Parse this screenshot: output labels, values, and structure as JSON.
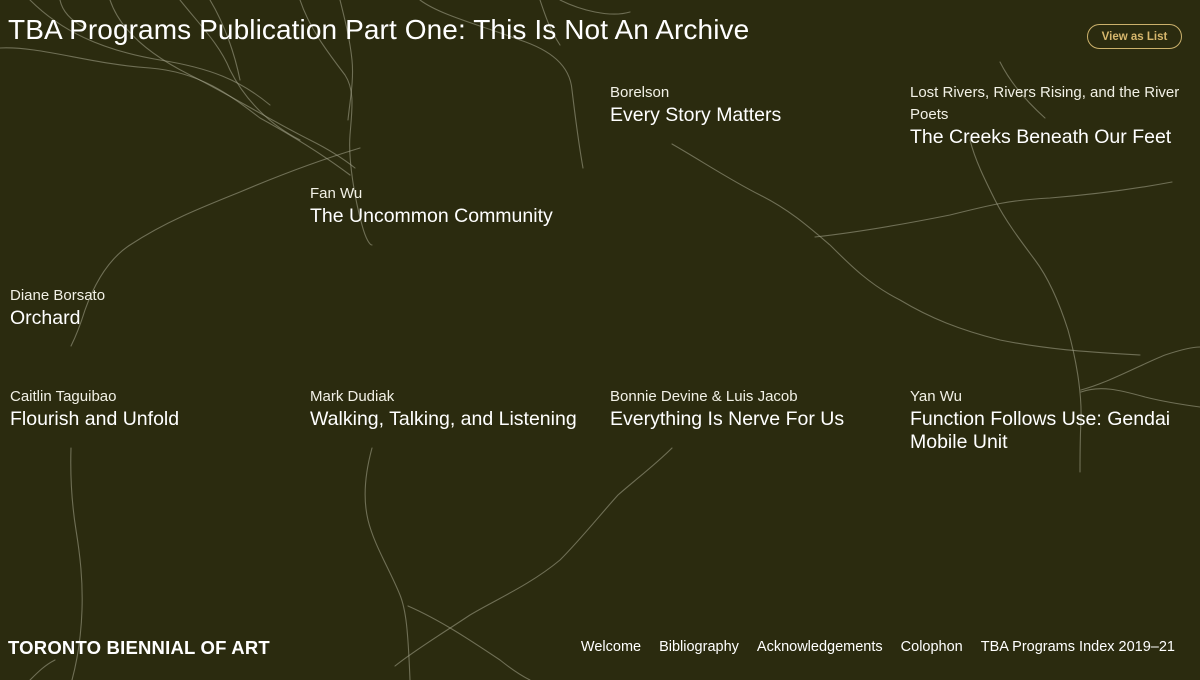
{
  "header": {
    "title": "TBA Programs Publication Part One: This Is Not An Archive",
    "view_button_label": "View as List"
  },
  "entries": [
    {
      "artist": "Borelson",
      "work": "Every Story Matters"
    },
    {
      "artist": "Lost Rivers, Rivers Rising, and the River Poets",
      "work": "The Creeks Beneath Our Feet"
    },
    {
      "artist": "Fan Wu",
      "work": "The Uncommon Community"
    },
    {
      "artist": "Diane Borsato",
      "work": "Orchard"
    },
    {
      "artist": "Caitlin Taguibao",
      "work": "Flourish and Unfold"
    },
    {
      "artist": "Mark Dudiak",
      "work": "Walking, Talking, and Listening"
    },
    {
      "artist": "Bonnie Devine & Luis Jacob",
      "work": "Everything Is Nerve For Us"
    },
    {
      "artist": "Yan Wu",
      "work": "Function Follows Use: Gendai Mobile Unit"
    }
  ],
  "footer": {
    "logo": "TORONTO BIENNIAL OF ART",
    "nav": [
      "Welcome",
      "Bibliography",
      "Acknowledgements",
      "Colophon",
      "TBA Programs Index 2019–21"
    ]
  },
  "colors": {
    "background": "#2b2b0f",
    "accent": "#d7b76d",
    "text": "#ffffff",
    "lines": "#a8a78f"
  }
}
